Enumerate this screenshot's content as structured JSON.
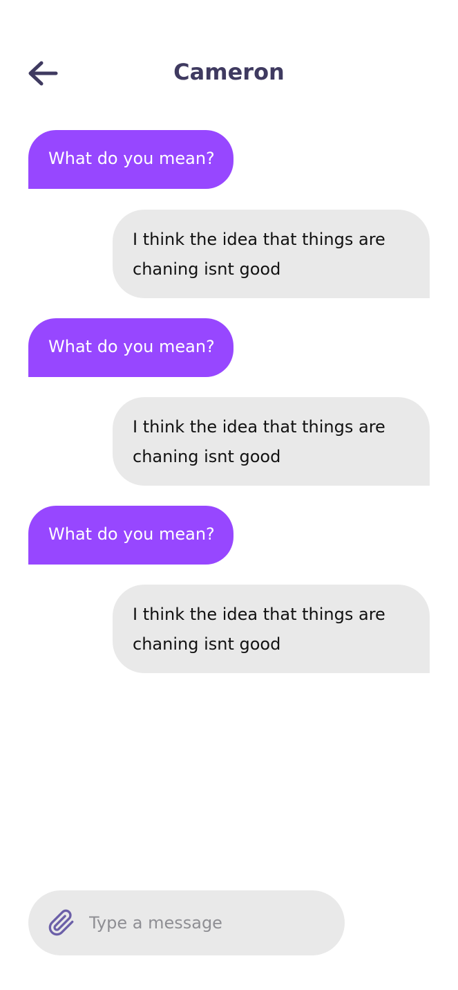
{
  "header": {
    "title": "Cameron",
    "back_icon": "arrow-left-icon"
  },
  "colors": {
    "accent": "#9747ff",
    "title": "#3f3a60",
    "bubble_grey": "#e9e9e9"
  },
  "messages": [
    {
      "direction": "incoming",
      "text": "What do you mean?"
    },
    {
      "direction": "outgoing",
      "text": "I think the idea that things are chaning isnt good"
    },
    {
      "direction": "incoming",
      "text": "What do you mean?"
    },
    {
      "direction": "outgoing",
      "text": "I think the idea that things are chaning isnt good"
    },
    {
      "direction": "incoming",
      "text": "What do you mean?"
    },
    {
      "direction": "outgoing",
      "text": "I think the idea that things are chaning isnt good"
    }
  ],
  "composer": {
    "placeholder": "Type a message",
    "value": "",
    "attach_icon": "paperclip-icon"
  }
}
